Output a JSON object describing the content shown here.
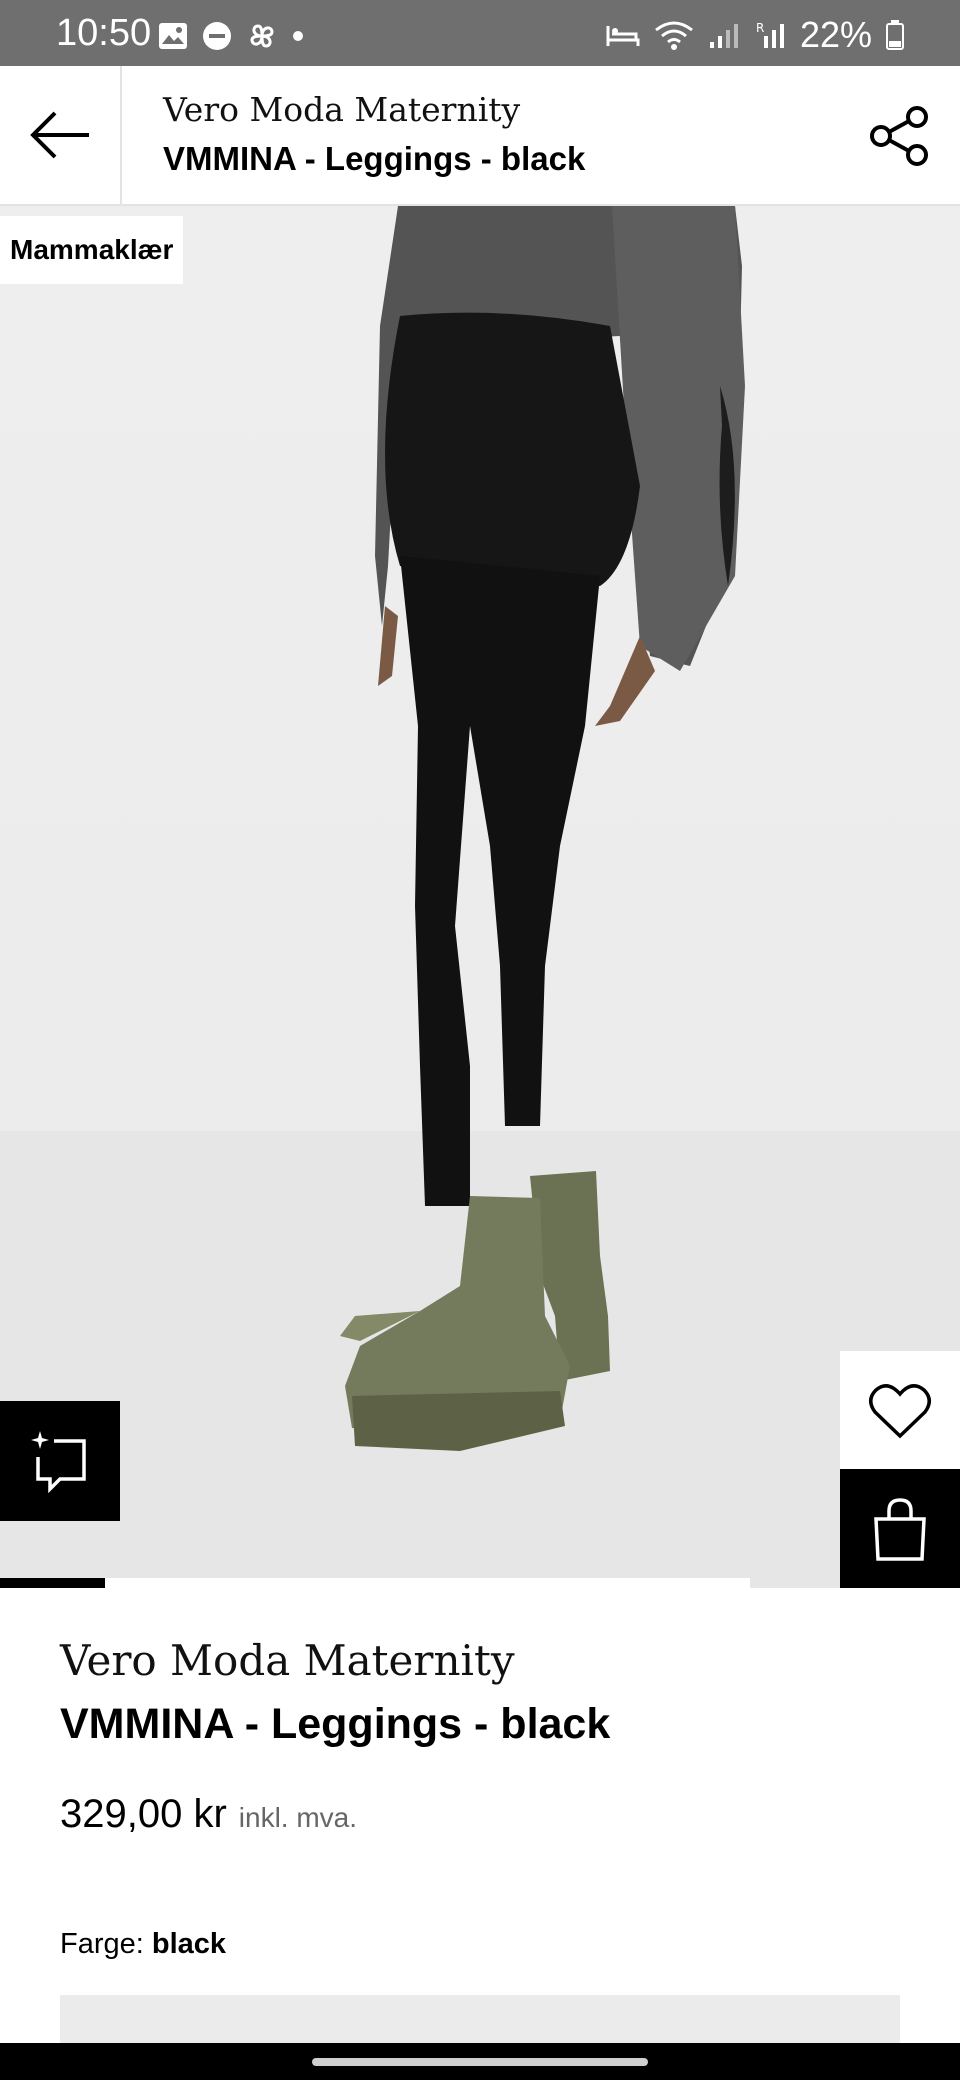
{
  "status_bar": {
    "time": "10:50",
    "battery": "22%"
  },
  "header": {
    "brand": "Vero Moda Maternity",
    "title": "VMMINA - Leggings - black"
  },
  "image": {
    "badge": "Mammaklær",
    "carousel_progress": 0.14
  },
  "product": {
    "brand": "Vero Moda Maternity",
    "title": "VMMINA - Leggings - black",
    "price": "329,00 kr",
    "vat_note": "inkl. mva.",
    "color_label": "Farge:",
    "color_value": "black"
  },
  "icons": {
    "back": "arrow-left-icon",
    "share": "share-icon",
    "wishlist": "heart-icon",
    "bag": "shopping-bag-icon",
    "ai": "ai-sparkle-chat-icon"
  }
}
